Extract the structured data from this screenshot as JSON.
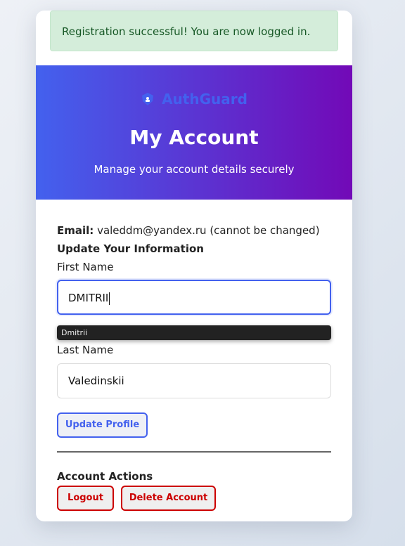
{
  "alert": {
    "message": "Registration successful! You are now logged in."
  },
  "brand": {
    "name": "AuthGuard",
    "icon": "shield-icon"
  },
  "header": {
    "title": "My Account",
    "subtitle": "Manage your account details securely"
  },
  "account": {
    "email_label": "Email:",
    "email_value": "valeddm@yandex.ru (cannot be changed)"
  },
  "form": {
    "section_title": "Update Your Information",
    "first_name_label": "First Name",
    "first_name_value": "DMITRII",
    "autofill_suggestion": "Dmitrii",
    "last_name_label": "Last Name",
    "last_name_value": "Valedinskii",
    "submit_label": "Update Profile"
  },
  "actions": {
    "title": "Account Actions",
    "logout_label": "Logout",
    "delete_label": "Delete Account"
  },
  "colors": {
    "primary": "#4361ee",
    "gradient_end": "#7209b7",
    "danger": "#cc0000",
    "success_bg": "#d4edda"
  }
}
